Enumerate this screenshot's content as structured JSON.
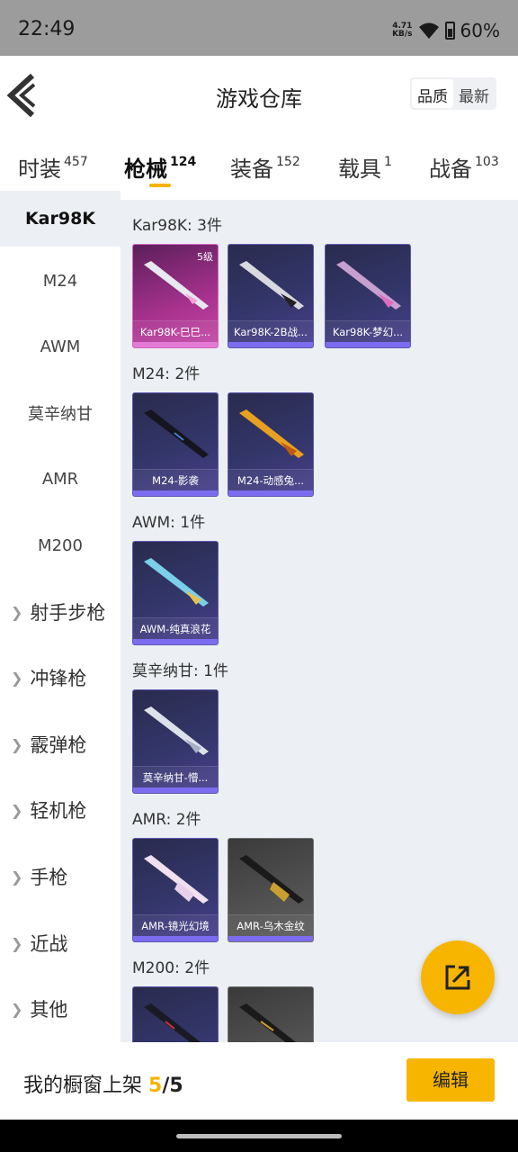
{
  "status_bar": {
    "time": "22:49",
    "net_speed": "4.71",
    "net_unit": "KB/s",
    "battery": "60%"
  },
  "header": {
    "title": "游戏仓库",
    "sort": [
      {
        "label": "品质",
        "active": true
      },
      {
        "label": "最新",
        "active": false
      }
    ]
  },
  "tabs": [
    {
      "label": "时装",
      "count": "457"
    },
    {
      "label": "枪械",
      "count": "124",
      "active": true
    },
    {
      "label": "装备",
      "count": "152"
    },
    {
      "label": "载具",
      "count": "1"
    },
    {
      "label": "战备",
      "count": "103"
    }
  ],
  "sidebar": {
    "items": [
      "Kar98K",
      "M24",
      "AWM",
      "莫辛纳甘",
      "AMR",
      "M200"
    ],
    "groups": [
      "射手步枪",
      "冲锋枪",
      "霰弹枪",
      "轻机枪",
      "手枪",
      "近战",
      "其他"
    ]
  },
  "sections": [
    {
      "title": "Kar98K: 3件",
      "items": [
        {
          "name": "Kar98K-巳巳...",
          "level": "5级",
          "rarity": "pink"
        },
        {
          "name": "Kar98K-2B战...",
          "rarity": "purple"
        },
        {
          "name": "Kar98K-梦幻...",
          "rarity": "purple"
        }
      ]
    },
    {
      "title": "M24: 2件",
      "items": [
        {
          "name": "M24-影袭",
          "rarity": "purple"
        },
        {
          "name": "M24-动感兔...",
          "rarity": "purple"
        }
      ]
    },
    {
      "title": "AWM: 1件",
      "items": [
        {
          "name": "AWM-纯真浪花",
          "rarity": "purple"
        }
      ]
    },
    {
      "title": "莫辛纳甘: 1件",
      "items": [
        {
          "name": "莫辛纳甘-懵...",
          "rarity": "purple"
        }
      ]
    },
    {
      "title": "AMR: 2件",
      "items": [
        {
          "name": "AMR-镜光幻境",
          "rarity": "purple"
        },
        {
          "name": "AMR-乌木金纹",
          "rarity": "gray"
        }
      ]
    },
    {
      "title": "M200: 2件",
      "items": [
        {
          "name": "",
          "rarity": "purple"
        },
        {
          "name": "",
          "rarity": "gray"
        }
      ]
    }
  ],
  "bottom": {
    "showcase_label": "我的橱窗上架",
    "showcase_current": "5",
    "showcase_total": "/5",
    "edit_label": "编辑"
  },
  "colors": {
    "accent": "#f7b500",
    "purple_bar": "#7c6cf0",
    "pink": "#c64aa8"
  },
  "icons": {
    "back": "chevron-left-icon",
    "fab": "share-external-icon"
  }
}
